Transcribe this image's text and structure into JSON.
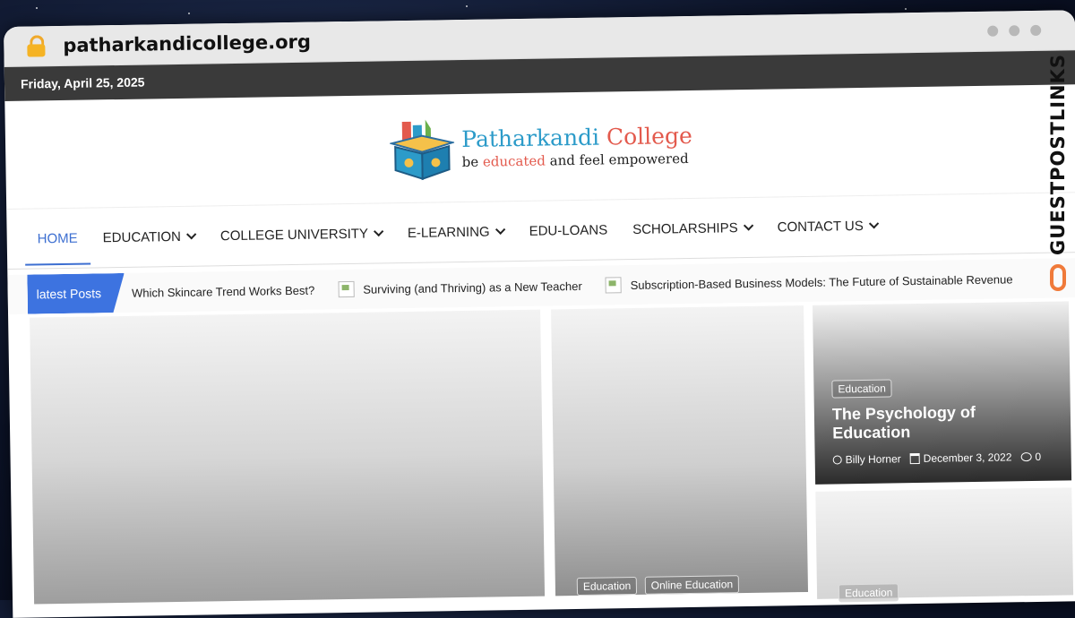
{
  "browser": {
    "url": "patharkandicollege.org"
  },
  "topbar": {
    "date": "Friday, April 25, 2025"
  },
  "logo": {
    "brand_1": "Patharkandi",
    "brand_2": "College",
    "tag_1": "be ",
    "tag_2": "educated",
    "tag_3": " and feel empowered"
  },
  "nav": {
    "items": [
      {
        "label": "HOME"
      },
      {
        "label": "EDUCATION"
      },
      {
        "label": "COLLEGE UNIVERSITY"
      },
      {
        "label": "E-LEARNING"
      },
      {
        "label": "EDU-LOANS"
      },
      {
        "label": "SCHOLARSHIPS"
      },
      {
        "label": "CONTACT US"
      }
    ]
  },
  "ticker": {
    "label": "latest Posts",
    "items": [
      "Which Skincare Trend Works Best?",
      "Surviving (and Thriving) as a New Teacher",
      "Subscription-Based Business Models: The Future of Sustainable Revenue"
    ]
  },
  "featured": {
    "card2_tags": [
      "Education",
      "Online Education"
    ],
    "card3": {
      "tag": "Education",
      "title": "The Psychology of Education",
      "author": "Billy Horner",
      "date": "December 3, 2022",
      "comments": "0"
    },
    "card4_tag": "Education"
  },
  "watermark": {
    "text": "GUESTPOSTLINKS"
  },
  "colors": {
    "accent": "#3d73e0",
    "topbar": "#3a3a3a",
    "brand_blue": "#2c9bc9",
    "brand_red": "#e35a4d"
  }
}
